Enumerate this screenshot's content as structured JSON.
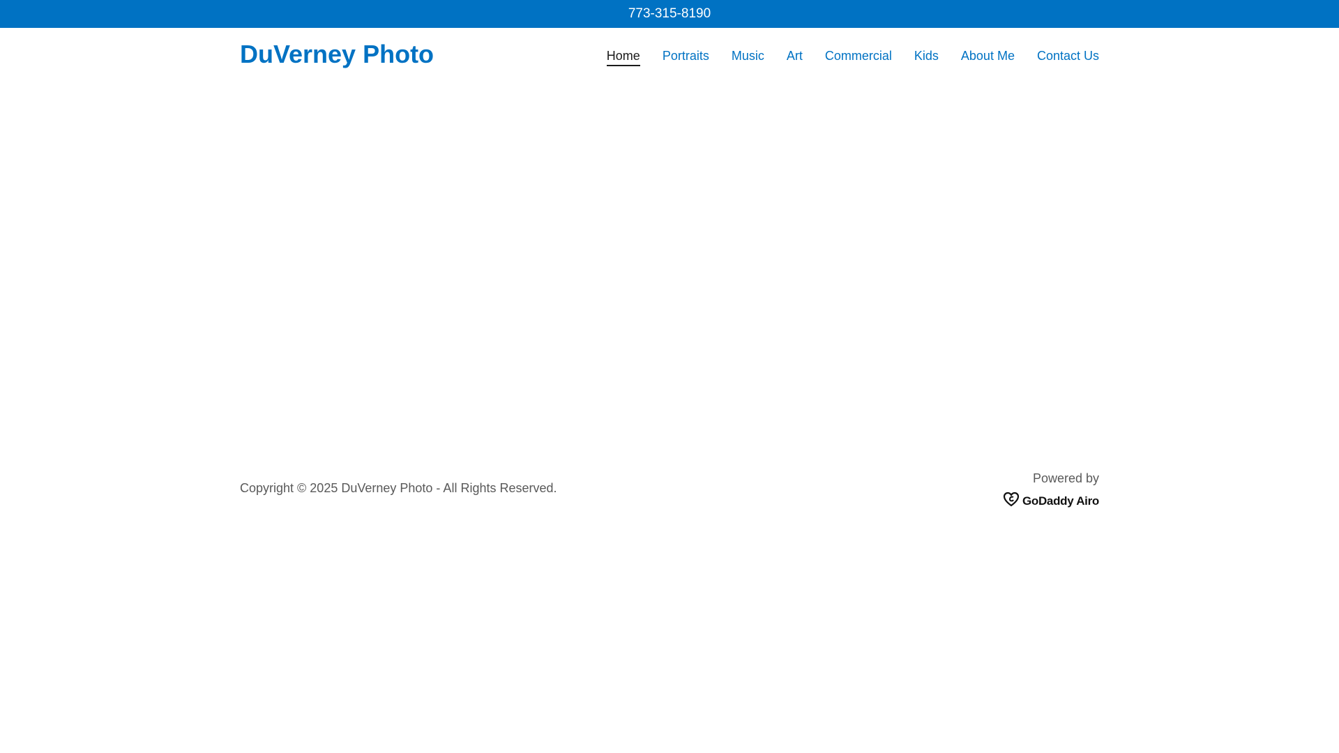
{
  "topbar": {
    "phone": "773-315-8190"
  },
  "header": {
    "brand": "DuVerney Photo",
    "nav": [
      {
        "label": "Home",
        "active": true
      },
      {
        "label": "Portraits"
      },
      {
        "label": "Music"
      },
      {
        "label": "Art"
      },
      {
        "label": "Commercial"
      },
      {
        "label": "Kids"
      },
      {
        "label": "About Me"
      },
      {
        "label": "Contact Us"
      }
    ]
  },
  "footer": {
    "copyright": "Copyright © 2025 DuVerney Photo - All Rights Reserved.",
    "powered_by": "Powered by",
    "logo_text": "GoDaddy Airo",
    "logo_icon": "godaddy-heart-icon"
  },
  "colors": {
    "brand_blue": "#0072c3",
    "active_nav": "#1b1b1b",
    "footer_text": "#595959"
  }
}
